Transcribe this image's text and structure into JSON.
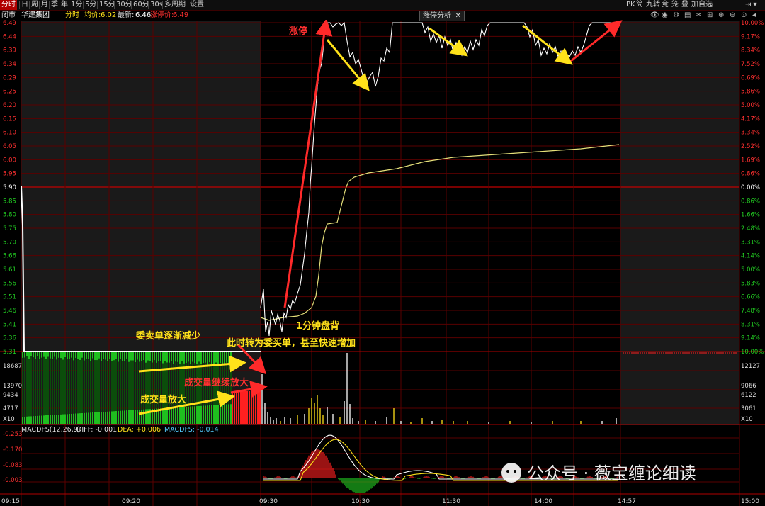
{
  "toolbar": {
    "items": [
      "分时",
      "日",
      "周",
      "月",
      "季",
      "年",
      "1分",
      "5分",
      "15分",
      "30分",
      "60分",
      "30s",
      "多周期",
      "设置"
    ],
    "active_index": 0,
    "right_items": [
      "PK",
      "简",
      "九转",
      "竞",
      "笼",
      "叠",
      "加自选"
    ]
  },
  "info": {
    "status": "闭市",
    "stock_name": "华建集团",
    "mode": "分时",
    "avg_label": "均价:",
    "avg_value": "6.02",
    "latest_label": "最新:",
    "latest_value": "6.46",
    "limit_label": "涨停价:",
    "limit_value": "6.49"
  },
  "floating_tab": {
    "label": "涨停分析",
    "close": "✕"
  },
  "price_axis": {
    "left": [
      "6.49",
      "6.44",
      "6.39",
      "6.34",
      "6.29",
      "6.25",
      "6.20",
      "6.15",
      "6.10",
      "6.05",
      "6.00",
      "5.95",
      "5.90",
      "5.85",
      "5.80",
      "5.75",
      "5.70",
      "5.66",
      "5.61",
      "5.56",
      "5.51",
      "5.46",
      "5.41",
      "5.36",
      "5.31"
    ],
    "right": [
      "10.00%",
      "9.17%",
      "8.34%",
      "7.52%",
      "6.69%",
      "5.86%",
      "5.00%",
      "4.17%",
      "3.34%",
      "2.52%",
      "1.69%",
      "0.86%",
      "0.00%",
      "0.86%",
      "1.66%",
      "2.48%",
      "3.31%",
      "4.14%",
      "5.00%",
      "5.83%",
      "6.66%",
      "7.48%",
      "8.31%",
      "9.14%",
      "10.00%"
    ]
  },
  "volume_axis": {
    "left": [
      "18687",
      "13970",
      "9434",
      "4717",
      "X10"
    ],
    "right": [
      "12127",
      "9066",
      "6122",
      "3061",
      "X10"
    ]
  },
  "macd": {
    "header": "MACDFS(12,26,9)",
    "diff": "DIFF: -0.001",
    "dea": "DEA: +0.006",
    "macdfs": "MACDFS: -0.014",
    "axis": [
      "-0.253",
      "-0.170",
      "-0.083",
      "-0.003"
    ]
  },
  "time_axis": [
    "09:15",
    "09:20",
    "09:30",
    "10:30",
    "11:30",
    "14:00",
    "14:57",
    "15:00"
  ],
  "annotations": {
    "limit_up": "涨停",
    "sell_orders_decrease": "委卖单逐渐减少",
    "turn_to_buy": "此时转为委买单，甚至快速增加",
    "volume_up": "成交量放大",
    "volume_keep_up": "成交量继续放大",
    "divergence": "1分钟盘背"
  },
  "watermark": "公众号 · 薇宝缠论细读",
  "colors": {
    "grid": "#7a0000",
    "price_line": "#ffffff",
    "avg_line": "#e5e07a",
    "up_red": "#ff2020",
    "down_green": "#22cc22",
    "arrow_red": "#ff2a2a",
    "arrow_yellow": "#ffe21a",
    "text_yellow": "#ffe21a",
    "text_red": "#ff3030"
  }
}
